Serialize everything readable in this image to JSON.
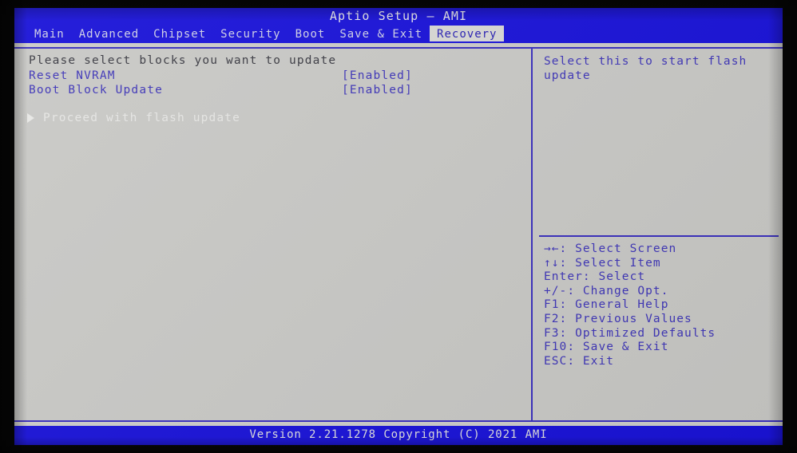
{
  "title_bar": {
    "title": "Aptio Setup – AMI"
  },
  "menu": {
    "tabs": [
      {
        "label": "Main",
        "selected": false
      },
      {
        "label": "Advanced",
        "selected": false
      },
      {
        "label": "Chipset",
        "selected": false
      },
      {
        "label": "Security",
        "selected": false
      },
      {
        "label": "Boot",
        "selected": false
      },
      {
        "label": "Save & Exit",
        "selected": false
      },
      {
        "label": "Recovery",
        "selected": true
      }
    ]
  },
  "left_pane": {
    "section_header": "Please select blocks you want to update",
    "settings": [
      {
        "label": "Reset NVRAM",
        "value": "[Enabled]"
      },
      {
        "label": "Boot Block Update",
        "value": "[Enabled]"
      }
    ],
    "action": {
      "arrow_icon": "triangle-right-icon",
      "label": "Proceed with flash update"
    }
  },
  "help_pane": {
    "help_text": "Select this to start flash update",
    "key_legend": [
      "→←: Select Screen",
      "↑↓: Select Item",
      "Enter: Select",
      "+/-: Change Opt.",
      "F1: General Help",
      "F2: Previous Values",
      "F3: Optimized Defaults",
      "F10: Save & Exit",
      "ESC: Exit"
    ]
  },
  "footer": {
    "version_text": "Version 2.21.1278 Copyright (C) 2021 AMI"
  },
  "colors": {
    "header_blue": "#1a13d8",
    "screen_gray": "#c9c9c6",
    "text_blue": "#3f36b8",
    "rule_blue": "#3a2fbe",
    "header_text": "#3b3b43",
    "selected_text": "#e6e6e4",
    "tab_selected_bg": "#d8d8d5"
  }
}
